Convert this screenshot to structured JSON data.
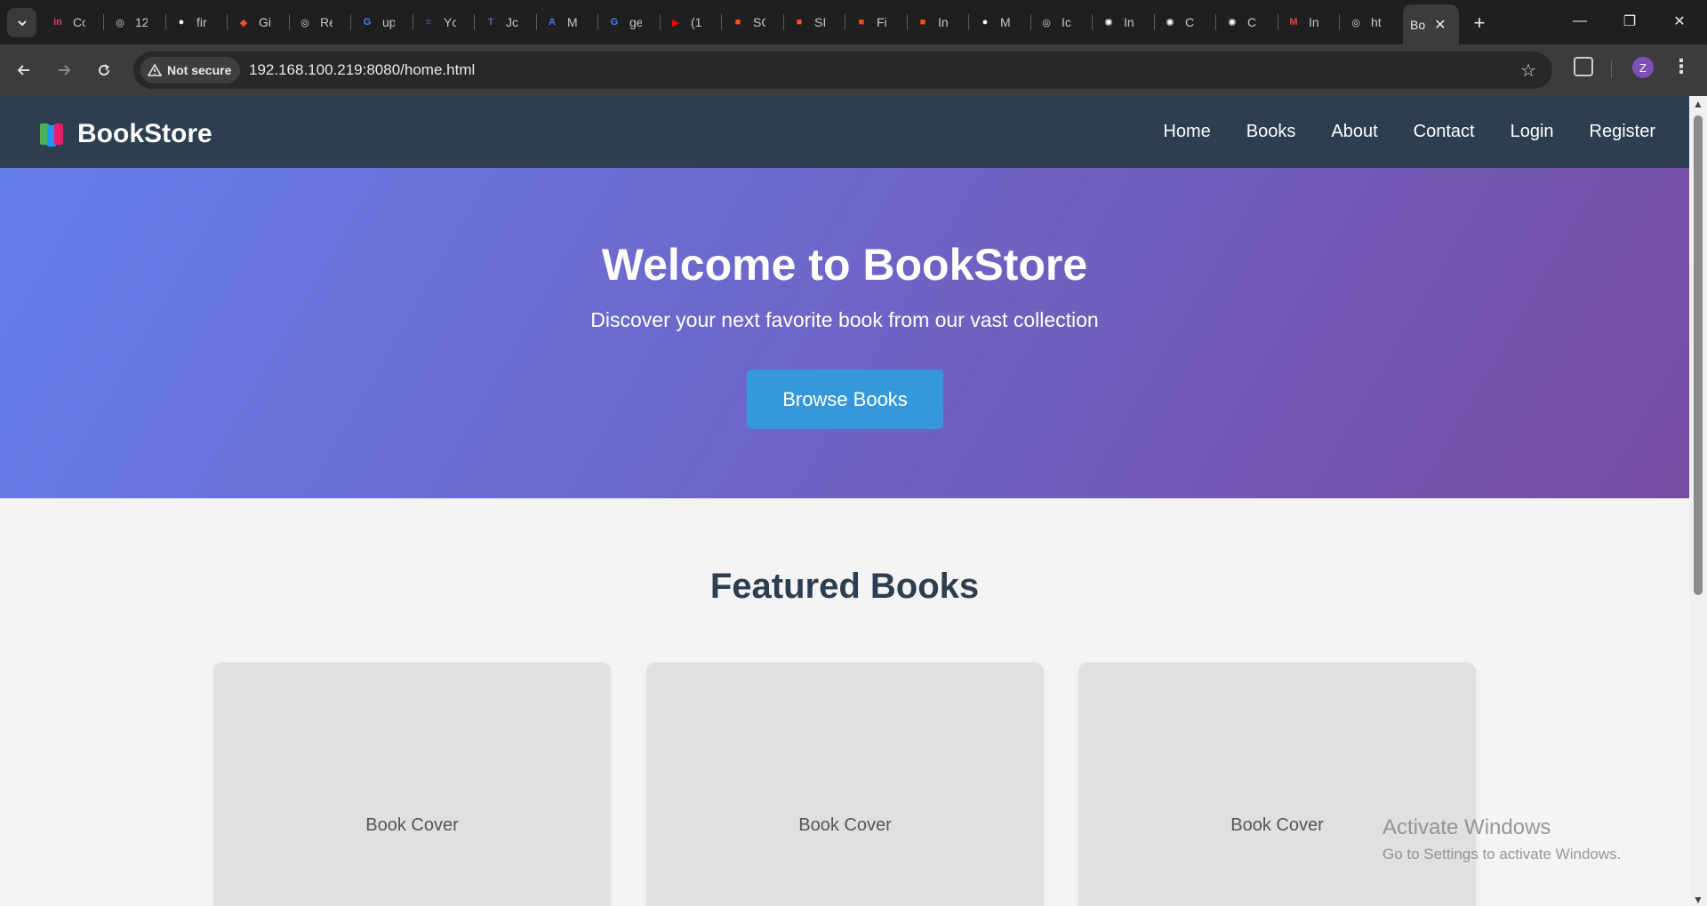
{
  "browser": {
    "tabs": [
      {
        "title": "Cc",
        "icon": "invision-icon",
        "color": "#ff3366",
        "glyph": "in"
      },
      {
        "title": "12",
        "icon": "globe-icon",
        "color": "#dcdcdc",
        "glyph": "◎"
      },
      {
        "title": "fir",
        "icon": "github-icon",
        "color": "#ffffff",
        "glyph": "●"
      },
      {
        "title": "Gi",
        "icon": "git-icon",
        "color": "#f05133",
        "glyph": "◆"
      },
      {
        "title": "Re",
        "icon": "globe-icon",
        "color": "#dcdcdc",
        "glyph": "◎"
      },
      {
        "title": "up",
        "icon": "google-icon",
        "color": "#4285f4",
        "glyph": "G"
      },
      {
        "title": "Yc",
        "icon": "forms-icon",
        "color": "#7248b9",
        "glyph": "≡"
      },
      {
        "title": "Jc",
        "icon": "teams-icon",
        "color": "#5b5fc7",
        "glyph": "T"
      },
      {
        "title": "M",
        "icon": "translate-icon",
        "color": "#3b82f6",
        "glyph": "A"
      },
      {
        "title": "ge",
        "icon": "google-icon",
        "color": "#4285f4",
        "glyph": "G"
      },
      {
        "title": "(1",
        "icon": "youtube-icon",
        "color": "#ff0000",
        "glyph": "▶"
      },
      {
        "title": "SC",
        "icon": "microsoft-icon",
        "color": "#f25022",
        "glyph": "■"
      },
      {
        "title": "SI",
        "icon": "microsoft-icon",
        "color": "#f25022",
        "glyph": "■"
      },
      {
        "title": "Fi",
        "icon": "microsoft-icon",
        "color": "#f25022",
        "glyph": "■"
      },
      {
        "title": "In",
        "icon": "microsoft-icon",
        "color": "#f25022",
        "glyph": "■"
      },
      {
        "title": "M",
        "icon": "github-icon",
        "color": "#ffffff",
        "glyph": "●"
      },
      {
        "title": "Ic",
        "icon": "globe-icon",
        "color": "#dcdcdc",
        "glyph": "◎"
      },
      {
        "title": "In",
        "icon": "chatgpt-icon",
        "color": "#ffffff",
        "glyph": "✺"
      },
      {
        "title": "C",
        "icon": "chatgpt-icon",
        "color": "#ffffff",
        "glyph": "✺"
      },
      {
        "title": "C",
        "icon": "chatgpt-icon",
        "color": "#ffffff",
        "glyph": "✺"
      },
      {
        "title": "In",
        "icon": "gmail-icon",
        "color": "#ea4335",
        "glyph": "M"
      },
      {
        "title": "ht",
        "icon": "globe-icon",
        "color": "#dcdcdc",
        "glyph": "◎"
      }
    ],
    "active_tab": {
      "title": "Bo"
    },
    "not_secure_label": "Not secure",
    "url": "192.168.100.219:8080/home.html",
    "profile_initial": "Z"
  },
  "site": {
    "logo_text": "BookStore",
    "nav": [
      "Home",
      "Books",
      "About",
      "Contact",
      "Login",
      "Register"
    ],
    "colors": {
      "header": "#2c3e50",
      "hero_start": "#667eea",
      "hero_end": "#764ba2",
      "button": "#3498db"
    }
  },
  "hero": {
    "title": "Welcome to BookStore",
    "subtitle": "Discover your next favorite book from our vast collection",
    "cta": "Browse Books"
  },
  "featured": {
    "title": "Featured Books",
    "cards": [
      "Book Cover",
      "Book Cover",
      "Book Cover"
    ]
  },
  "watermark": {
    "line1": "Activate Windows",
    "line2": "Go to Settings to activate Windows."
  }
}
